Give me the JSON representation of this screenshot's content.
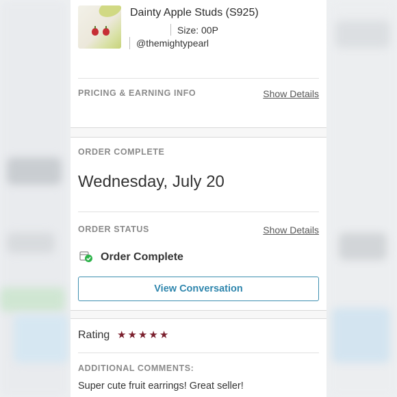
{
  "item": {
    "title": "Dainty Apple Studs (S925)",
    "size": "Size: 00P",
    "seller_handle": "@themightypearl",
    "thumbnail_icon": "apple-earrings-photo"
  },
  "pricing": {
    "label": "PRICING & EARNING INFO",
    "link": "Show Details"
  },
  "order_complete": {
    "label": "ORDER COMPLETE",
    "date": "Wednesday, July 20"
  },
  "order_status": {
    "label": "ORDER STATUS",
    "link": "Show Details",
    "status": "Order Complete",
    "status_icon": "package-check-icon"
  },
  "conversation_button": "View Conversation",
  "rating": {
    "label": "Rating",
    "stars": 5,
    "star_color": "#7a1e2c"
  },
  "comments": {
    "label": "ADDITIONAL COMMENTS:",
    "text": "Super cute fruit earrings! Great seller!"
  },
  "colors": {
    "accent": "#2f86ad",
    "status_green": "#2db34a"
  }
}
